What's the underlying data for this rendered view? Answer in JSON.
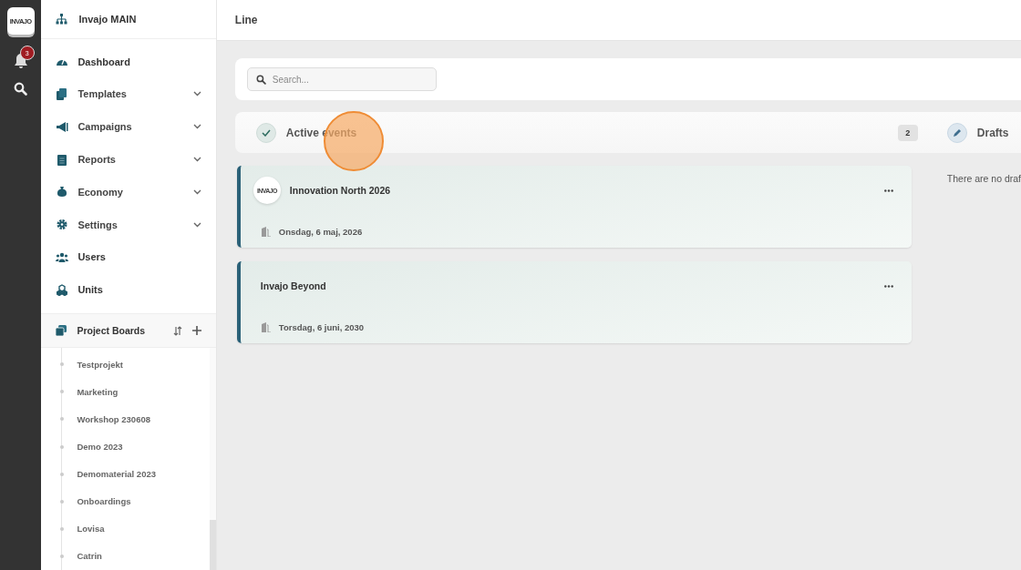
{
  "rail": {
    "logo": "INVAJO",
    "notifications": "3"
  },
  "org": {
    "title": "Invajo MAIN"
  },
  "nav": [
    {
      "label": "Dashboard",
      "expandable": false
    },
    {
      "label": "Templates",
      "expandable": true
    },
    {
      "label": "Campaigns",
      "expandable": true
    },
    {
      "label": "Reports",
      "expandable": true
    },
    {
      "label": "Economy",
      "expandable": true
    },
    {
      "label": "Settings",
      "expandable": true
    },
    {
      "label": "Users",
      "expandable": false
    },
    {
      "label": "Units",
      "expandable": false
    }
  ],
  "boards": {
    "title": "Project Boards",
    "items": [
      "Testprojekt",
      "Marketing",
      "Workshop 230608",
      "Demo 2023",
      "Demomaterial 2023",
      "Onboardings",
      "Lovisa",
      "Catrin"
    ]
  },
  "page": {
    "title": "Line"
  },
  "search": {
    "placeholder": "Search..."
  },
  "active": {
    "title": "Active events",
    "count": "2"
  },
  "events": [
    {
      "title": "Innovation North 2026",
      "date": "Onsdag, 6 maj, 2026",
      "logo": "INVAJO"
    },
    {
      "title": "Invajo Beyond",
      "date": "Torsdag, 6 juni, 2030"
    }
  ],
  "drafts": {
    "title": "Drafts",
    "empty": "There are no draf"
  }
}
